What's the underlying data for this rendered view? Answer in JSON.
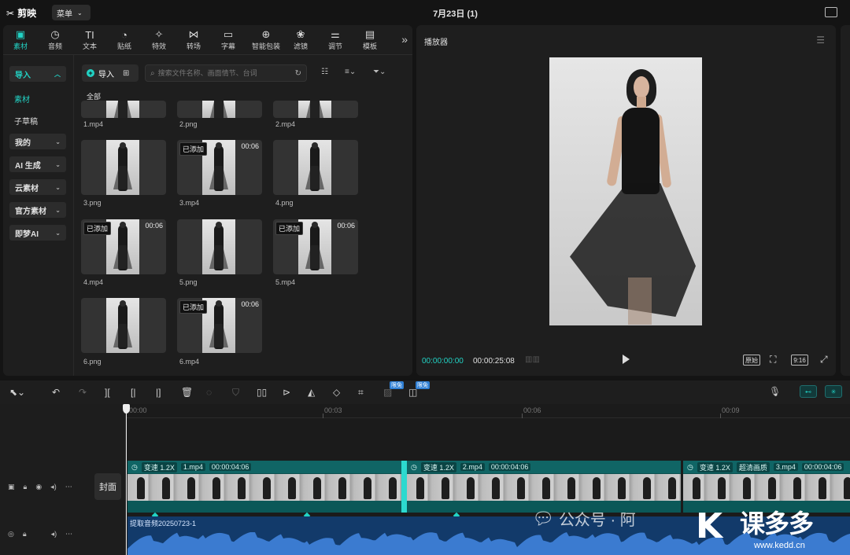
{
  "app": {
    "name": "剪映",
    "menu_label": "菜单",
    "doc_title": "7月23日 (1)"
  },
  "tools": [
    {
      "label": "素材",
      "icon": "media-icon",
      "active": true
    },
    {
      "label": "音频",
      "icon": "audio-icon"
    },
    {
      "label": "文本",
      "icon": "text-icon"
    },
    {
      "label": "贴纸",
      "icon": "sticker-icon"
    },
    {
      "label": "特效",
      "icon": "effects-icon"
    },
    {
      "label": "转场",
      "icon": "transition-icon"
    },
    {
      "label": "字幕",
      "icon": "subtitle-icon"
    },
    {
      "label": "智能包装",
      "icon": "smart-pack-icon"
    },
    {
      "label": "滤镜",
      "icon": "filter-icon"
    },
    {
      "label": "调节",
      "icon": "adjust-icon"
    },
    {
      "label": "模板",
      "icon": "template-icon"
    }
  ],
  "categories": {
    "import": "导入",
    "material": "素材",
    "subdraft": "子草稿",
    "mine": "我的",
    "ai_gen": "AI 生成",
    "cloud": "云素材",
    "official": "官方素材",
    "jimeng": "即梦AI"
  },
  "media": {
    "import_label": "导入",
    "search_placeholder": "搜索文件名称、画面情节、台词",
    "all_label": "全部",
    "added_label": "已添加",
    "top_row": [
      "1.mp4",
      "2.png",
      "2.mp4"
    ],
    "items": [
      {
        "name": "3.png",
        "added": false,
        "duration": ""
      },
      {
        "name": "3.mp4",
        "added": true,
        "duration": "00:06"
      },
      {
        "name": "4.png",
        "added": false,
        "duration": ""
      },
      {
        "name": "4.mp4",
        "added": true,
        "duration": "00:06"
      },
      {
        "name": "5.png",
        "added": false,
        "duration": ""
      },
      {
        "name": "5.mp4",
        "added": true,
        "duration": "00:06"
      },
      {
        "name": "6.png",
        "added": false,
        "duration": ""
      },
      {
        "name": "6.mp4",
        "added": true,
        "duration": "00:06"
      }
    ]
  },
  "player": {
    "title": "播放器",
    "current_time": "00:00:00:00",
    "total_time": "00:00:25:08",
    "ratio_label": "9:16",
    "original_label": "原始"
  },
  "edit": {
    "free_tag": "限免"
  },
  "timeline": {
    "ticks": [
      "00:00",
      "00:03",
      "00:06",
      "00:09"
    ],
    "cover_label": "封面",
    "clips": [
      {
        "speed": "变速 1.2X",
        "name": "1.mp4",
        "duration": "00:00:04:06",
        "extra": ""
      },
      {
        "speed": "变速 1.2X",
        "name": "2.mp4",
        "duration": "00:00:04:06",
        "extra": ""
      },
      {
        "speed": "变速 1.2X",
        "name": "3.mp4",
        "duration": "00:00:04:06",
        "extra": "超清画质"
      }
    ],
    "audio_label": "提取音频20250723-1"
  },
  "watermark": {
    "wechat": "公众号 · 阿",
    "brand": "课多多",
    "url": "www.kedd.cn"
  },
  "colors": {
    "accent": "#22d3c5",
    "clip": "#0d4f4f",
    "audio": "#123a6a",
    "panel": "#1e1e1e"
  }
}
